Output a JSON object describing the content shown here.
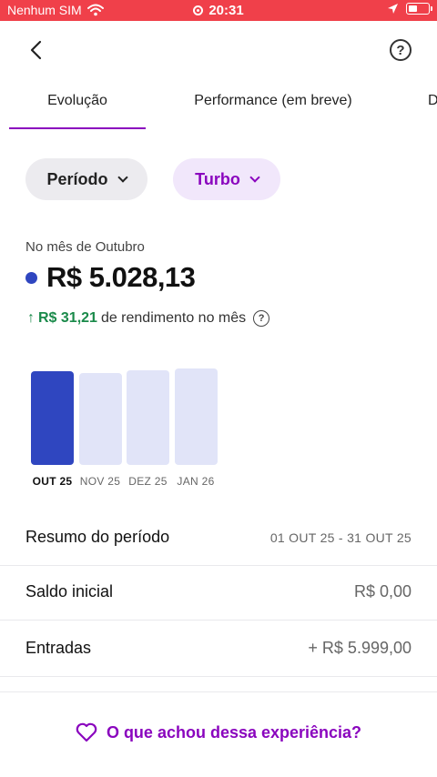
{
  "status_bar": {
    "carrier": "Nenhum SIM",
    "time": "20:31",
    "icons": [
      "wifi-icon",
      "recording-icon",
      "location-arrow-icon",
      "battery-icon"
    ],
    "color": "#f0404a"
  },
  "header": {
    "back_icon": "chevron-left-icon",
    "help_icon": "question-circle-icon",
    "help_glyph": "?"
  },
  "tabs": [
    {
      "label": "Evolução",
      "active": true
    },
    {
      "label": "Performance (em breve)",
      "active": false
    },
    {
      "label": "D",
      "active": false
    }
  ],
  "filters": {
    "period_label": "Período",
    "turbo_label": "Turbo"
  },
  "summary": {
    "month_label": "No mês de Outubro",
    "balance": "R$ 5.028,13",
    "yield_arrow": "↑",
    "yield_amount": "R$ 31,21",
    "yield_text": "de rendimento no mês",
    "info_glyph": "?"
  },
  "chart_data": {
    "type": "bar",
    "categories": [
      "OUT 25",
      "NOV 25",
      "DEZ 25",
      "JAN 26"
    ],
    "values": [
      5028.13,
      null,
      null,
      null
    ],
    "active_index": 0,
    "colors": {
      "active": "#2f46c0",
      "placeholder": "#e1e4f8"
    }
  },
  "rows": [
    {
      "label": "Resumo do período",
      "value": "01 OUT 25 - 31 OUT 25"
    },
    {
      "label": "Saldo inicial",
      "value": "R$ 0,00"
    },
    {
      "label": "Entradas",
      "value": "+ R$ 5.999,00"
    }
  ],
  "feedback": {
    "label": "O que achou dessa experiência?",
    "icon": "heart-icon"
  },
  "colors": {
    "accent": "#8a05be",
    "positive": "#1a8a4a"
  }
}
